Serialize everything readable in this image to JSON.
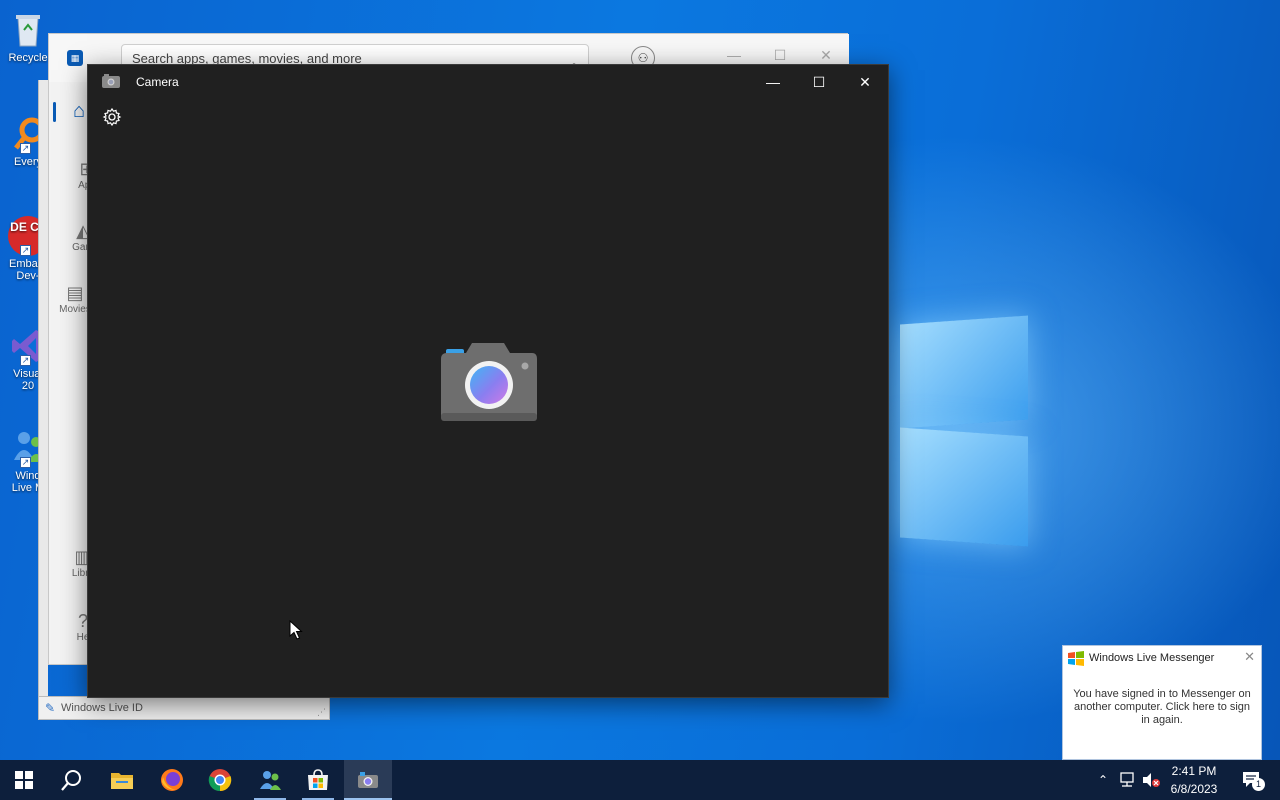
{
  "desktop": {
    "icons": [
      {
        "label": "Recycle",
        "icon": "recycle-bin-icon"
      },
      {
        "label": "Every",
        "icon": "everything-search-icon"
      },
      {
        "label_line1": "Embarc",
        "label_line2": "Dev-",
        "icon": "dev-cpp-icon",
        "glyph_text": "DE C+"
      },
      {
        "label_line1": "Visual",
        "label_line2": "20",
        "icon": "visual-studio-icon"
      },
      {
        "label_line1": "Wind",
        "label_line2": "Live M",
        "icon": "windows-live-messenger-icon"
      }
    ]
  },
  "store": {
    "search_placeholder": "Search apps, games, movies, and more",
    "sidebar": [
      {
        "label": "App",
        "icon": "apps-icon"
      },
      {
        "label": "Gam",
        "icon": "gaming-icon"
      },
      {
        "label": "Movies",
        "icon": "movies-icon"
      },
      {
        "label": "Libra",
        "icon": "library-icon"
      },
      {
        "label": "He",
        "icon": "help-icon"
      }
    ]
  },
  "liveid": {
    "label": "Windows Live ID"
  },
  "camera": {
    "title": "Camera",
    "minimize": "—",
    "maximize": "☐",
    "close": "✕"
  },
  "messenger_popup": {
    "title": "Windows Live Messenger",
    "message": "You have signed in to Messenger on another computer. Click here to sign in again.",
    "close": "✕"
  },
  "taskbar": {
    "apps": [
      {
        "name": "start-button",
        "icon": "windows-logo-icon"
      },
      {
        "name": "search-button",
        "icon": "search-icon"
      },
      {
        "name": "file-explorer",
        "icon": "folder-icon"
      },
      {
        "name": "firefox",
        "icon": "firefox-icon"
      },
      {
        "name": "chrome",
        "icon": "chrome-icon"
      },
      {
        "name": "messenger",
        "icon": "messenger-icon"
      },
      {
        "name": "microsoft-store",
        "icon": "store-icon"
      },
      {
        "name": "camera",
        "icon": "camera-icon"
      }
    ],
    "tray": {
      "time": "2:41 PM",
      "date": "6/8/2023",
      "notification_count": "1"
    }
  },
  "colors": {
    "accent": "#0a5bb5",
    "camera_bg": "#202020",
    "taskbar_bg": "#0d1f3c"
  }
}
